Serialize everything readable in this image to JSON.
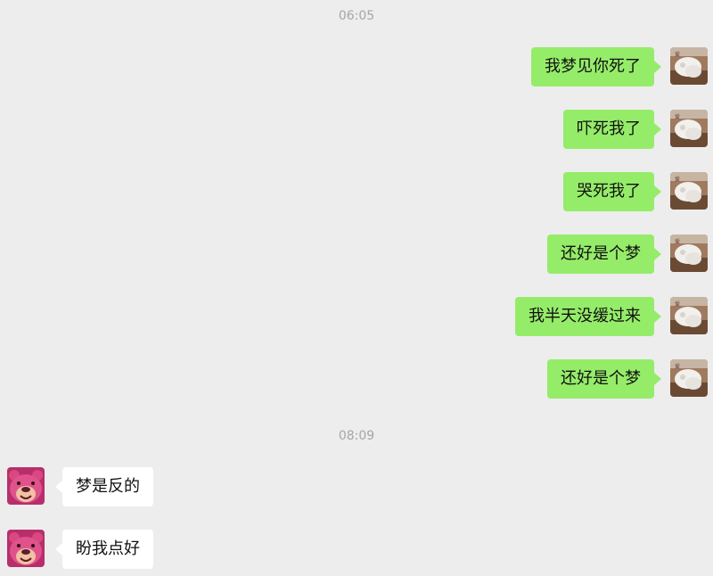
{
  "chat": {
    "timestamps": [
      "06:05",
      "08:09"
    ],
    "outgoing": [
      {
        "text": "我梦见你死了",
        "avatar": "cat-avatar-icon"
      },
      {
        "text": "吓死我了",
        "avatar": "cat-avatar-icon"
      },
      {
        "text": "哭死我了",
        "avatar": "cat-avatar-icon"
      },
      {
        "text": "还好是个梦",
        "avatar": "cat-avatar-icon"
      },
      {
        "text": "我半天没缓过来",
        "avatar": "cat-avatar-icon"
      },
      {
        "text": "还好是个梦",
        "avatar": "cat-avatar-icon"
      }
    ],
    "incoming": [
      {
        "text": "梦是反的",
        "avatar": "bear-avatar-icon"
      },
      {
        "text": "盼我点好",
        "avatar": "bear-avatar-icon"
      }
    ]
  },
  "colors": {
    "background": "#ededed",
    "outgoing_bubble": "#95ec69",
    "incoming_bubble": "#ffffff",
    "timestamp_text": "#a6a6a6"
  }
}
